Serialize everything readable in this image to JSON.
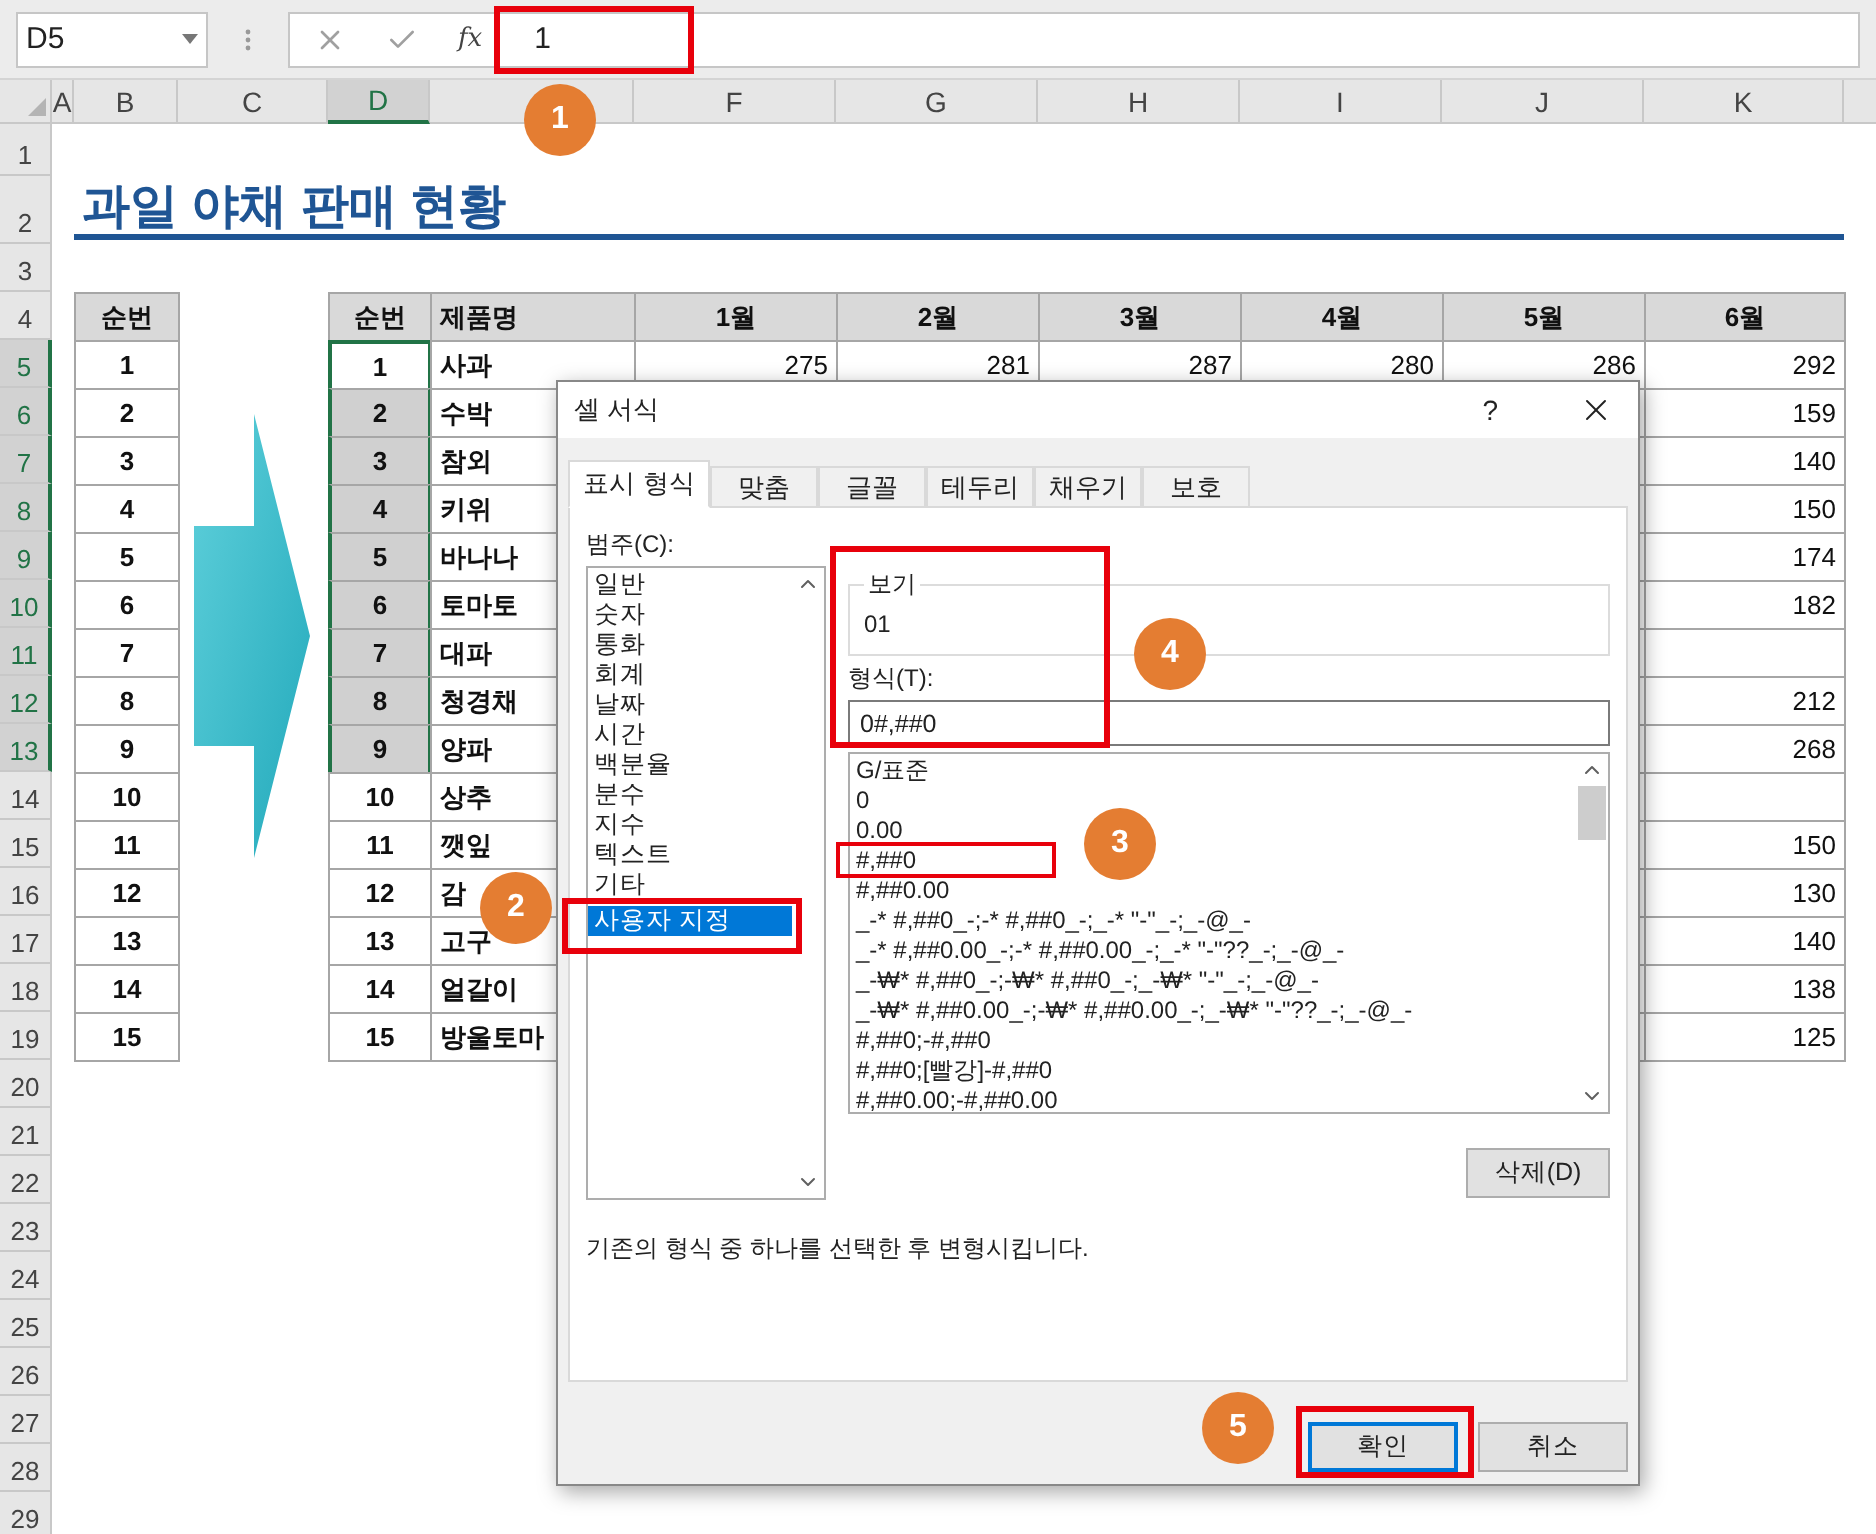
{
  "formula_bar": {
    "name_box": "D5",
    "function_label": "fx",
    "value": "1"
  },
  "columns": [
    {
      "label": "A",
      "selected": false
    },
    {
      "label": "B",
      "selected": false
    },
    {
      "label": "C",
      "selected": false
    },
    {
      "label": "D",
      "selected": true
    },
    {
      "selected": false
    },
    {
      "label": "F",
      "selected": false
    },
    {
      "label": "G",
      "selected": false
    },
    {
      "label": "H",
      "selected": false
    },
    {
      "label": "I",
      "selected": false
    },
    {
      "label": "J",
      "selected": false
    },
    {
      "label": "K",
      "selected": false
    }
  ],
  "rows": [
    {
      "label": "1",
      "selected": false
    },
    {
      "label": "2",
      "selected": false
    },
    {
      "label": "3",
      "selected": false
    },
    {
      "label": "4",
      "selected": false
    },
    {
      "label": "5",
      "selected": true
    },
    {
      "label": "6",
      "selected": true
    },
    {
      "label": "7",
      "selected": true
    },
    {
      "label": "8",
      "selected": true
    },
    {
      "label": "9",
      "selected": true
    },
    {
      "label": "10",
      "selected": true
    },
    {
      "label": "11",
      "selected": true
    },
    {
      "label": "12",
      "selected": true
    },
    {
      "label": "13",
      "selected": true
    },
    {
      "label": "14",
      "selected": false
    },
    {
      "label": "15",
      "selected": false
    },
    {
      "label": "16",
      "selected": false
    },
    {
      "label": "17",
      "selected": false
    },
    {
      "label": "18",
      "selected": false
    },
    {
      "label": "19",
      "selected": false
    },
    {
      "label": "20",
      "selected": false
    },
    {
      "label": "21",
      "selected": false
    },
    {
      "label": "22",
      "selected": false
    },
    {
      "label": "23",
      "selected": false
    },
    {
      "label": "24",
      "selected": false
    },
    {
      "label": "25",
      "selected": false
    },
    {
      "label": "26",
      "selected": false
    },
    {
      "label": "27",
      "selected": false
    },
    {
      "label": "28",
      "selected": false
    },
    {
      "label": "29",
      "selected": false
    }
  ],
  "title": "과일 야채 판매 현황",
  "left_table": {
    "header": "순번",
    "values": [
      "1",
      "2",
      "3",
      "4",
      "5",
      "6",
      "7",
      "8",
      "9",
      "10",
      "11",
      "12",
      "13",
      "14",
      "15"
    ]
  },
  "main_table": {
    "columns": [
      "순번",
      "제품명",
      "1월",
      "2월",
      "3월",
      "4월",
      "5월",
      "6월"
    ],
    "rows": [
      {
        "no": "1",
        "name": "사과",
        "values": [
          "275",
          "281",
          "287",
          "280",
          "286",
          "292"
        ],
        "selected": true,
        "active": true
      },
      {
        "no": "2",
        "name": "수박",
        "june": "159",
        "selected": true,
        "active": false
      },
      {
        "no": "3",
        "name": "참외",
        "june": "140",
        "selected": true,
        "active": false
      },
      {
        "no": "4",
        "name": "키위",
        "june": "150",
        "selected": true,
        "active": false
      },
      {
        "no": "5",
        "name": "바나나",
        "june": "174",
        "selected": true,
        "active": false
      },
      {
        "no": "6",
        "name": "토마토",
        "june": "182",
        "selected": true,
        "active": false
      },
      {
        "no": "7",
        "name": "대파",
        "selected": true,
        "active": false
      },
      {
        "no": "8",
        "name": "청경채",
        "june": "212",
        "selected": true,
        "active": false
      },
      {
        "no": "9",
        "name": "양파",
        "june": "268",
        "selected": true,
        "active": false
      },
      {
        "no": "10",
        "name": "상추",
        "selected": false,
        "active": false
      },
      {
        "no": "11",
        "name": "깻잎",
        "june": "150",
        "selected": false,
        "active": false
      },
      {
        "no": "12",
        "name": "감",
        "june": "130",
        "selected": false,
        "active": false
      },
      {
        "no": "13",
        "name": "고구",
        "june": "140",
        "selected": false,
        "active": false
      },
      {
        "no": "14",
        "name": "얼갈이",
        "june": "138",
        "selected": false,
        "active": false
      },
      {
        "no": "15",
        "name": "방울토마",
        "june": "125",
        "selected": false,
        "active": false
      }
    ]
  },
  "dialog": {
    "title": "셀 서식",
    "help": "?",
    "tabs": [
      {
        "label": "표시 형식",
        "selected": true
      },
      {
        "label": "맞춤",
        "selected": false
      },
      {
        "label": "글꼴",
        "selected": false
      },
      {
        "label": "테두리",
        "selected": false
      },
      {
        "label": "채우기",
        "selected": false
      },
      {
        "label": "보호",
        "selected": false
      }
    ],
    "category_label": "범주(C):",
    "categories": [
      {
        "label": "일반",
        "selected": false
      },
      {
        "label": "숫자",
        "selected": false
      },
      {
        "label": "통화",
        "selected": false
      },
      {
        "label": "회계",
        "selected": false
      },
      {
        "label": "날짜",
        "selected": false
      },
      {
        "label": "시간",
        "selected": false
      },
      {
        "label": "백분율",
        "selected": false
      },
      {
        "label": "분수",
        "selected": false
      },
      {
        "label": "지수",
        "selected": false
      },
      {
        "label": "텍스트",
        "selected": false
      },
      {
        "label": "기타",
        "selected": false
      },
      {
        "label": "사용자 지정",
        "selected": true
      }
    ],
    "preview_label": "보기",
    "preview_value": "01",
    "format_label": "형식(T):",
    "format_value": "0#,##0",
    "formats": [
      "G/표준",
      "0",
      "0.00",
      "#,##0",
      "#,##0.00",
      "_-* #,##0_-;-* #,##0_-;_-* \"-\"_-;_-@_-",
      "_-* #,##0.00_-;-* #,##0.00_-;_-* \"-\"??_-;_-@_-",
      "_-₩* #,##0_-;-₩* #,##0_-;_-₩* \"-\"_-;_-@_-",
      "_-₩* #,##0.00_-;-₩* #,##0.00_-;_-₩* \"-\"??_-;_-@_-",
      "#,##0;-#,##0",
      "#,##0;[빨강]-#,##0",
      "#,##0.00;-#,##0.00"
    ],
    "delete_button": "삭제(D)",
    "description": "기존의 형식 중 하나를 선택한 후 변형시킵니다.",
    "ok_button": "확인",
    "cancel_button": "취소"
  },
  "annotations": [
    {
      "label": "1"
    },
    {
      "label": "2"
    },
    {
      "label": "3"
    },
    {
      "label": "4"
    },
    {
      "label": "5"
    }
  ]
}
